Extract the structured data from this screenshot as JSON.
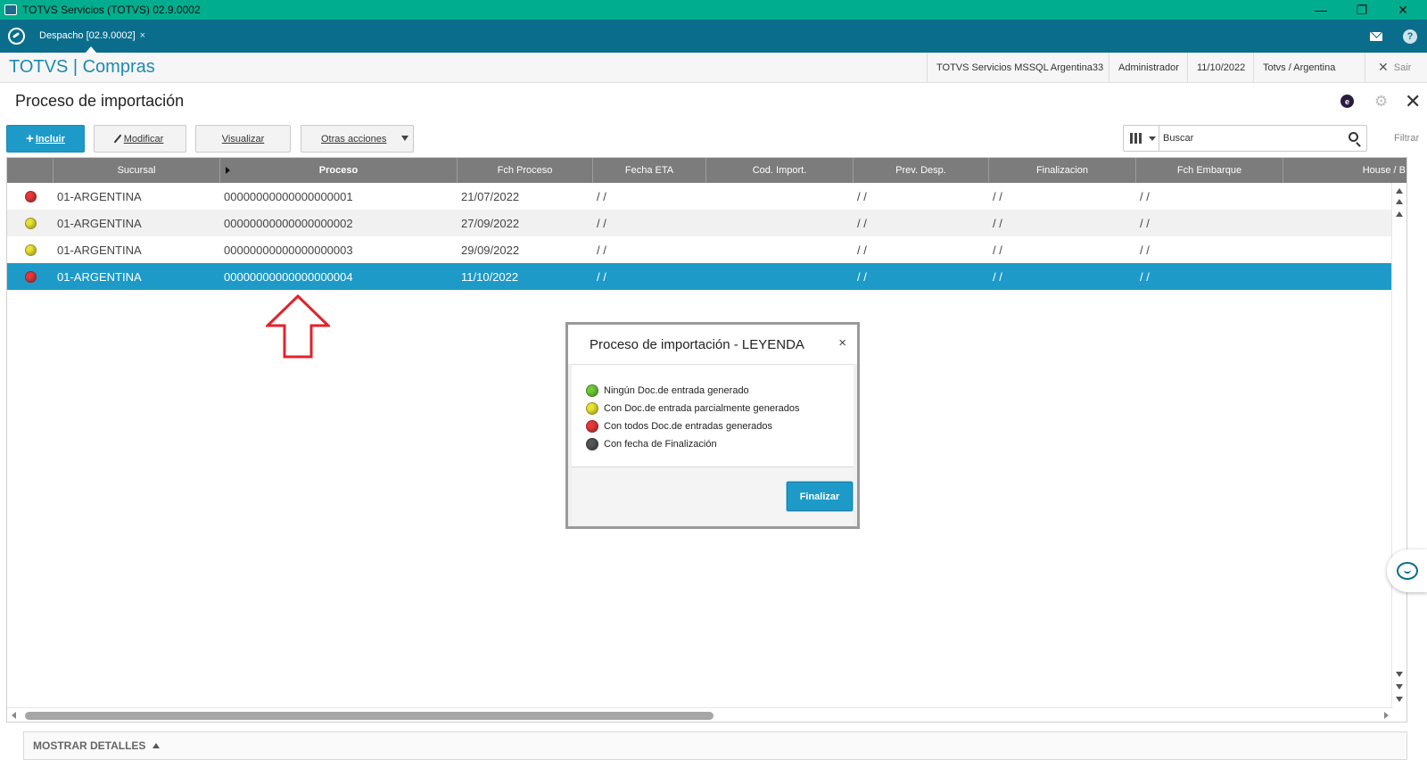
{
  "window": {
    "title": "TOTVS Servicios (TOTVS) 02.9.0002",
    "minimize": "—",
    "restore": "❐",
    "close": "✕"
  },
  "tabbar": {
    "active_tab": "Despacho [02.9.0002]",
    "tab_close": "×"
  },
  "module_header": {
    "brand": "TOTVS | Compras",
    "environment": "TOTVS Servicios MSSQL Argentina33",
    "user": "Administrador",
    "date": "11/10/2022",
    "company": "Totvs / Argentina",
    "logout": "Sair"
  },
  "page": {
    "title": "Proceso de importación",
    "badge": "e"
  },
  "toolbar": {
    "incluir": "Incluir",
    "modificar": "Modificar",
    "visualizar": "Visualizar",
    "otras_acciones": "Otras acciones",
    "search_placeholder": "Buscar",
    "filtrar": "Filtrar"
  },
  "grid": {
    "columns": [
      "",
      "Sucursal",
      "Proceso",
      "Fch Proceso",
      "Fecha ETA",
      "Cod. Import.",
      "Prev. Desp.",
      "Finalizacion",
      "Fch Embarque",
      "House / B"
    ],
    "rows": [
      {
        "status": "red",
        "sucursal": "01-ARGENTINA",
        "proceso": "00000000000000000001",
        "fch_proceso": "21/07/2022",
        "fecha_eta": "/ /",
        "cod_import": "",
        "prev_desp": "/ /",
        "finalizacion": "/ /",
        "fch_embarque": "/ /",
        "house": ""
      },
      {
        "status": "yellow",
        "sucursal": "01-ARGENTINA",
        "proceso": "00000000000000000002",
        "fch_proceso": "27/09/2022",
        "fecha_eta": "/ /",
        "cod_import": "",
        "prev_desp": "/ /",
        "finalizacion": "/ /",
        "fch_embarque": "/ /",
        "house": ""
      },
      {
        "status": "yellow",
        "sucursal": "01-ARGENTINA",
        "proceso": "00000000000000000003",
        "fch_proceso": "29/09/2022",
        "fecha_eta": "/ /",
        "cod_import": "",
        "prev_desp": "/ /",
        "finalizacion": "/ /",
        "fch_embarque": "/ /",
        "house": ""
      },
      {
        "status": "red",
        "sucursal": "01-ARGENTINA",
        "proceso": "00000000000000000004",
        "fch_proceso": "11/10/2022",
        "fecha_eta": "/ /",
        "cod_import": "",
        "prev_desp": "/ /",
        "finalizacion": "/ /",
        "fch_embarque": "/ /",
        "house": "",
        "selected": true
      }
    ]
  },
  "details": {
    "label": "MOSTRAR DETALLES"
  },
  "modal": {
    "title": "Proceso de importación - LEYENDA",
    "close": "×",
    "items": [
      {
        "color": "green",
        "label": "Ningún Doc.de entrada generado"
      },
      {
        "color": "yellow",
        "label": "Con Doc.de entrada parcialmente generados"
      },
      {
        "color": "red",
        "label": "Con todos Doc.de entradas generados"
      },
      {
        "color": "gray",
        "label": "Con fecha de Finalización"
      }
    ],
    "finalizar": "Finalizar"
  },
  "colors": {
    "green": "#6ecb3a",
    "yellow": "#e9e333",
    "red": "#e63a3a",
    "gray": "#555555",
    "accent": "#1d9ac8",
    "titlebar": "#00ae8f",
    "tabbar": "#0b6d8c"
  },
  "icons": [
    "app-icon",
    "totvs-logo-icon",
    "mail-icon",
    "help-icon",
    "gear-icon",
    "close-icon",
    "plus-icon",
    "pencil-icon",
    "columns-icon",
    "search-icon",
    "chat-icon",
    "red-arrow-annotation"
  ]
}
